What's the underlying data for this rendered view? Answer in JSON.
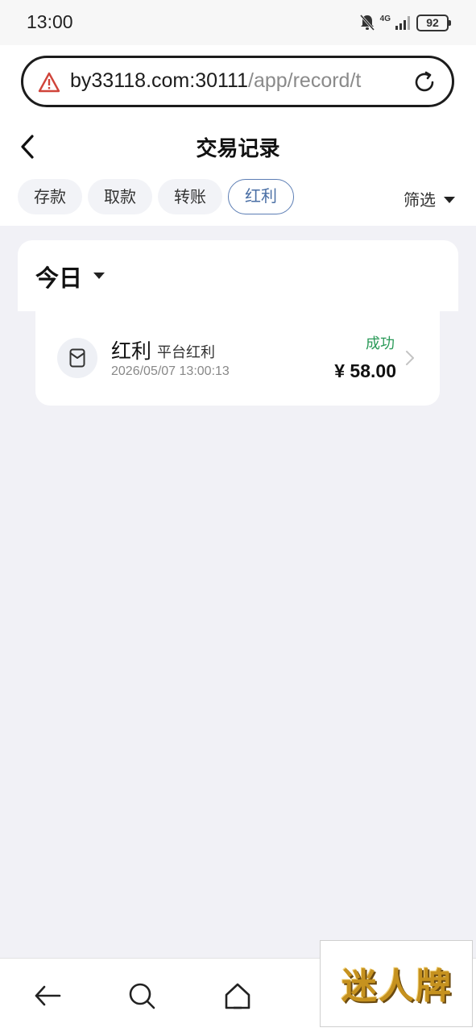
{
  "status_bar": {
    "time": "13:00",
    "network": "4G",
    "battery": "92"
  },
  "browser": {
    "url_host": "by33118.com:30111",
    "url_path": "/app/record/t"
  },
  "header": {
    "title": "交易记录"
  },
  "tabs": [
    {
      "label": "存款"
    },
    {
      "label": "取款"
    },
    {
      "label": "转账"
    },
    {
      "label": "红利",
      "active": true
    }
  ],
  "filter": {
    "label": "筛选"
  },
  "section": {
    "day_label": "今日"
  },
  "records": [
    {
      "type": "红利",
      "subtitle": "平台红利",
      "time": "2026/05/07 13:00:13",
      "status": "成功",
      "amount": "¥ 58.00"
    }
  ],
  "colors": {
    "status_success": "#2a9a58",
    "tab_active": "#4a6fa5",
    "warning": "#d0443a"
  },
  "watermark": {
    "text": "迷人牌"
  }
}
